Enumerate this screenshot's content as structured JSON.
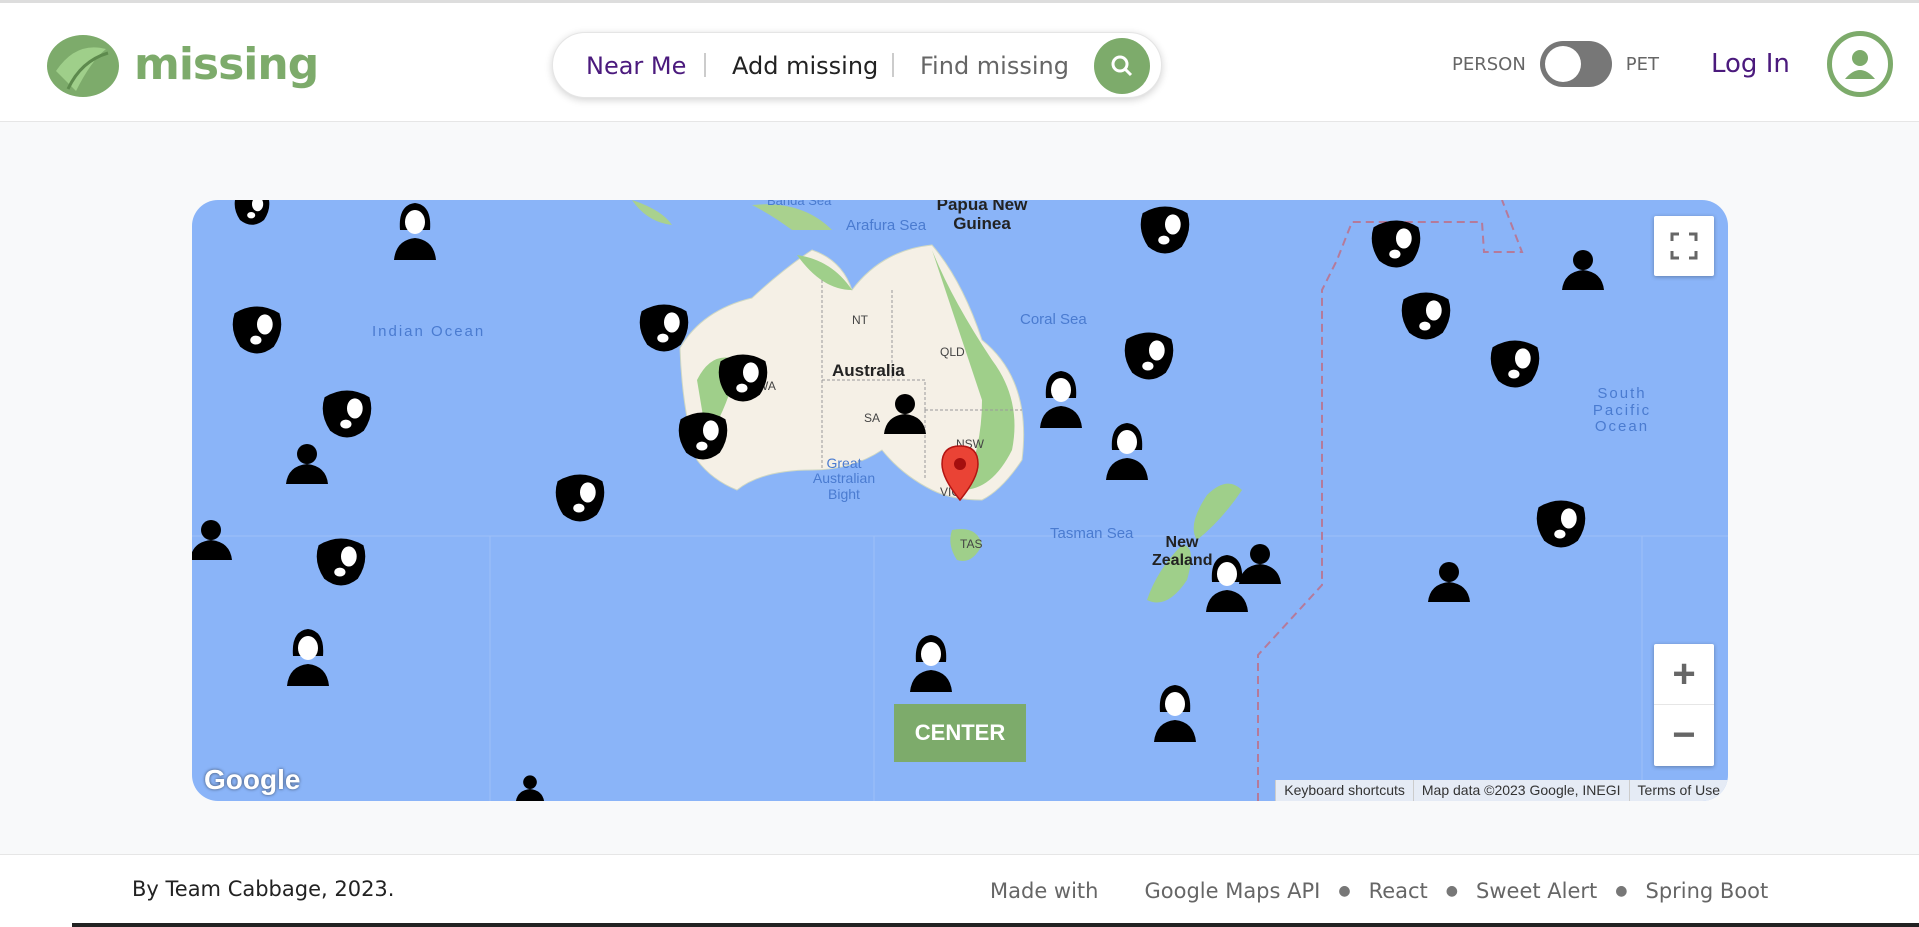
{
  "header": {
    "logo_text": "missing",
    "nav": {
      "near_me": "Near Me",
      "add_missing": "Add missing",
      "find_missing": "Find missing"
    },
    "toggle": {
      "left_label": "PERSON",
      "right_label": "PET",
      "state": "PERSON"
    },
    "login_label": "Log In"
  },
  "map": {
    "labels": {
      "indian_ocean": "Indian Ocean",
      "south_pacific": "South Pacific Ocean",
      "coral_sea": "Coral Sea",
      "tasman_sea": "Tasman Sea",
      "arafura_sea": "Arafura Sea",
      "banda_sea": "Banda Sea",
      "papua": "Papua New Guinea",
      "australia": "Australia",
      "nt": "NT",
      "qld": "QLD",
      "wa": "WA",
      "sa": "SA",
      "nsw": "NSW",
      "vic": "VIC",
      "tas": "TAS",
      "gab": "Great Australian Bight",
      "nz": "New Zealand"
    },
    "center_label": "CENTER",
    "google": "Google",
    "attribution": [
      "Keyboard shortcuts",
      "Map data ©2023 Google, INEGI",
      "Terms of Use"
    ],
    "colors": {
      "water": "#8ab4f8",
      "land": "#f5f0e6",
      "green_land": "#9fcf8a",
      "accent": "#7dab6b"
    }
  },
  "footer": {
    "credit": "By Team Cabbage, 2023.",
    "made_with": "Made with",
    "tech": [
      "Google Maps API",
      "React",
      "Sweet Alert",
      "Spring Boot"
    ]
  }
}
